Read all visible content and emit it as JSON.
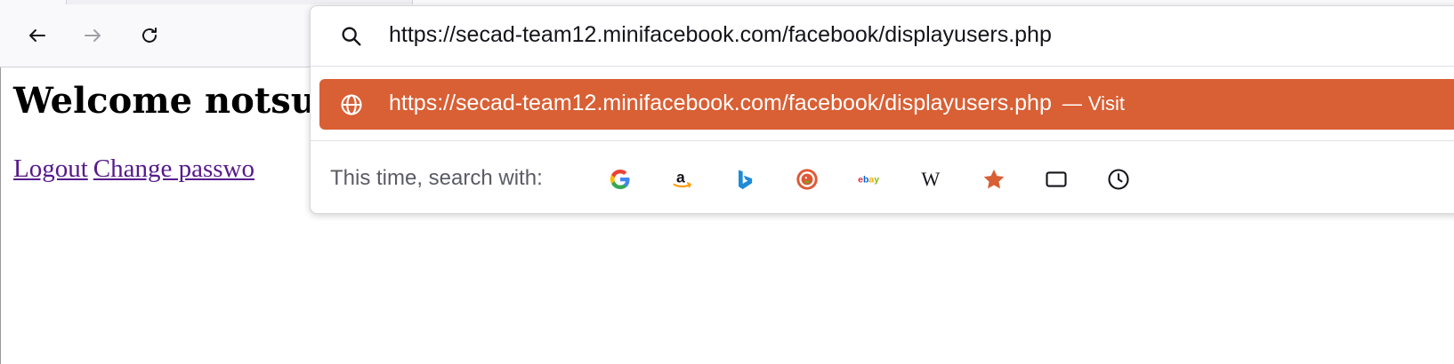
{
  "toolbar": {
    "back_icon": "arrow-left-icon",
    "forward_icon": "arrow-right-icon",
    "reload_icon": "reload-icon"
  },
  "page": {
    "heading": "Welcome notsu",
    "links": [
      "Logout",
      "Change passwo"
    ]
  },
  "urlbar": {
    "value": "https://secad-team12.minifacebook.com/facebook/displayusers.php",
    "search_icon": "search-icon"
  },
  "suggestion": {
    "url": "https://secad-team12.minifacebook.com/facebook/displayusers.php",
    "separator": "—",
    "action": "Visit",
    "icon": "globe-icon",
    "highlight_color": "#d95f34"
  },
  "search_engines": {
    "label": "This time, search with:",
    "items": [
      "google-icon",
      "amazon-icon",
      "bing-icon",
      "duckduckgo-icon",
      "ebay-icon",
      "wikipedia-icon",
      "bookmarks-icon",
      "tabs-icon",
      "history-icon"
    ],
    "ebay_text": "ebay",
    "wikipedia_text": "W"
  }
}
